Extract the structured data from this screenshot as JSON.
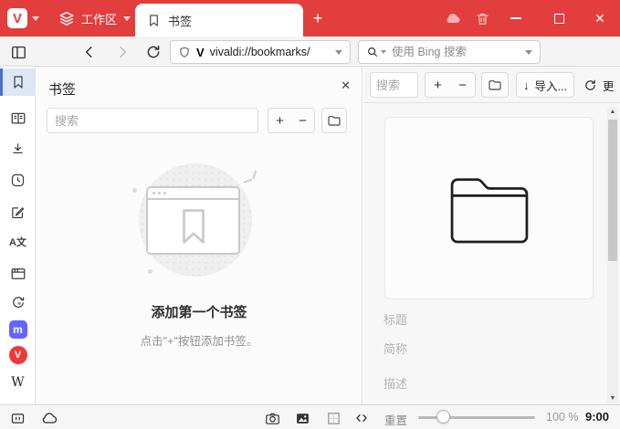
{
  "titlebar": {
    "workspace_label": "工作区",
    "tab_label": "书签"
  },
  "addressbar": {
    "url": "vivaldi://bookmarks/",
    "search_placeholder": "使用 Bing 搜索"
  },
  "panel": {
    "title": "书签",
    "search_placeholder": "搜索",
    "add_label": "+",
    "remove_label": "−",
    "empty_title": "添加第一个书签",
    "empty_subtitle": "点击\"+\"按钮添加书签。"
  },
  "manager": {
    "search_placeholder": "搜索",
    "add_label": "+",
    "remove_label": "−",
    "import_label": "导入...",
    "more_label": "更",
    "fields": {
      "title_placeholder": "标题",
      "nickname_placeholder": "简称",
      "description_placeholder": "描述"
    }
  },
  "statusbar": {
    "reset_label": "重置",
    "zoom_value": "100 %",
    "time": "9:00"
  },
  "icons": {
    "vivaldi_logo": "V",
    "vivaldi_favicon": "V",
    "mastodon": "m",
    "wikipedia": "W",
    "translate": "A文",
    "new_tab": "+",
    "window_close": "✕",
    "panel_close": "✕",
    "scroll_up": "▲",
    "scroll_down": "▼"
  },
  "colors": {
    "titlebar_red": "#e23e3e",
    "mastodon_purple": "#6364ff",
    "vivaldi_red": "#ef3939",
    "sidebar_active_bg": "#dde6f5",
    "sidebar_active_bar": "#4a72c8"
  }
}
